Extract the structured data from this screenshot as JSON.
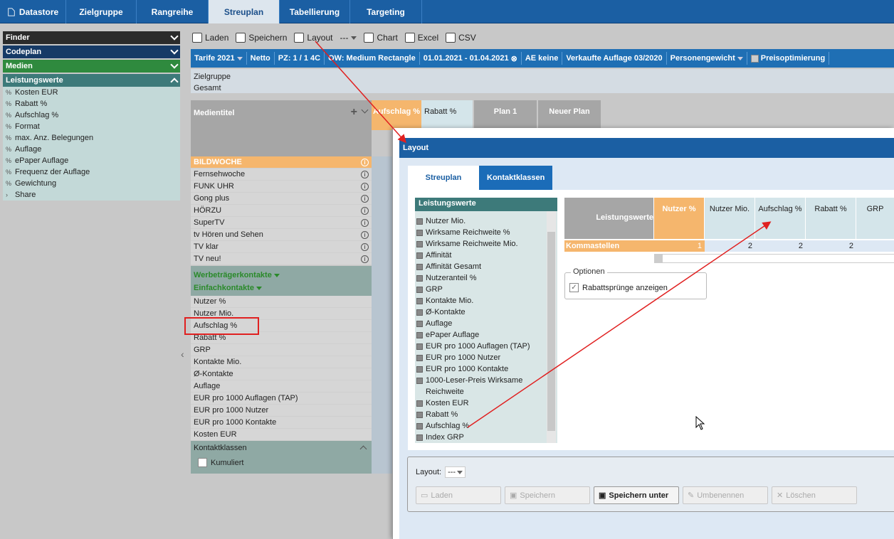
{
  "top_tabs": [
    {
      "label": "Datastore",
      "icon": "document-icon"
    },
    {
      "label": "Zielgruppe"
    },
    {
      "label": "Rangreihe"
    },
    {
      "label": "Streuplan",
      "active": true
    },
    {
      "label": "Tabellierung"
    },
    {
      "label": "Targeting"
    }
  ],
  "sidebar": {
    "sections": [
      "Finder",
      "Codeplan",
      "Medien",
      "Leistungswerte"
    ],
    "items": [
      "Kosten EUR",
      "Rabatt %",
      "Aufschlag %",
      "Format",
      "max. Anz. Belegungen",
      "Auflage",
      "ePaper Auflage",
      "Frequenz der Auflage",
      "Gewichtung",
      "Share"
    ]
  },
  "toolbar": {
    "laden": "Laden",
    "speichern": "Speichern",
    "layout": "Layout",
    "layout_value": "---",
    "chart": "Chart",
    "excel": "Excel",
    "csv": "CSV"
  },
  "filters": {
    "tarife": "Tarife 2021",
    "netto": "Netto",
    "pz": "PZ: 1 / 1 4C",
    "ow": "OW: Medium Rectangle",
    "date": "01.01.2021 - 01.04.2021",
    "ae": "AE keine",
    "auflage": "Verkaufte Auflage 03/2020",
    "gewicht": "Personengewicht",
    "preis": "Preisoptimierung"
  },
  "zielgruppe": {
    "label": "Zielgruppe",
    "value": "Gesamt"
  },
  "table": {
    "medientitel": "Medientitel",
    "col_aufschlag": "Aufschlag %",
    "col_rabatt": "Rabatt %",
    "col_plan1": "Plan 1",
    "col_neuer": "Neuer Plan",
    "medien": [
      "BILDWOCHE",
      "Fernsehwoche",
      "FUNK UHR",
      "Gong plus",
      "HÖRZU",
      "SuperTV",
      "tv Hören und Sehen",
      "TV klar",
      "TV neu!"
    ],
    "werbe": "Werbeträgerkontakte",
    "einfach": "Einfachkontakte",
    "leistung": [
      "Nutzer %",
      "Nutzer Mio.",
      "Aufschlag %",
      "Rabatt %",
      "GRP",
      "Kontakte Mio.",
      "Ø-Kontakte",
      "Auflage",
      "EUR pro 1000 Auflagen (TAP)",
      "EUR pro 1000 Nutzer",
      "EUR pro 1000 Kontakte",
      "Kosten EUR"
    ],
    "kontaktklassen": "Kontaktklassen",
    "kumuliert": "Kumuliert"
  },
  "modal": {
    "title": "Layout",
    "tabs": [
      "Streuplan",
      "Kontaktklassen"
    ],
    "list_header": "Leistungswerte",
    "list_items": [
      "Nutzer Mio.",
      "Wirksame Reichweite %",
      "Wirksame Reichweite Mio.",
      "Affinität",
      "Affinität Gesamt",
      "Nutzeranteil %",
      "GRP",
      "Kontakte Mio.",
      "Ø-Kontakte",
      "Auflage",
      "ePaper Auflage",
      "EUR pro 1000 Auflagen (TAP)",
      "EUR pro 1000 Nutzer",
      "EUR pro 1000 Kontakte",
      "1000-Leser-Preis Wirksame",
      "Reichweite",
      "Kosten EUR",
      "Rabatt %",
      "Aufschlag %",
      "Index GRP"
    ],
    "grid_header": "Leistungswerte",
    "grid_cols": [
      "Nutzer %",
      "Nutzer Mio.",
      "Aufschlag %",
      "Rabatt %",
      "GRP"
    ],
    "kommastellen": "Kommastellen",
    "grid_values": [
      "1",
      "2",
      "2",
      "2"
    ],
    "optionen": "Optionen",
    "rabatt_opt": "Rabattsprünge anzeigen",
    "layout_label": "Layout:",
    "layout_value": "---",
    "btn_laden": "Laden",
    "btn_speichern": "Speichern",
    "btn_speichern_unter": "Speichern unter",
    "btn_umbenennen": "Umbenennen",
    "btn_loeschen": "Löschen"
  },
  "colors": {
    "nav": "#1b5fa3",
    "accent_orange": "#f5b66d",
    "teal": "#3d7a7a",
    "annotation": "#e02020"
  }
}
